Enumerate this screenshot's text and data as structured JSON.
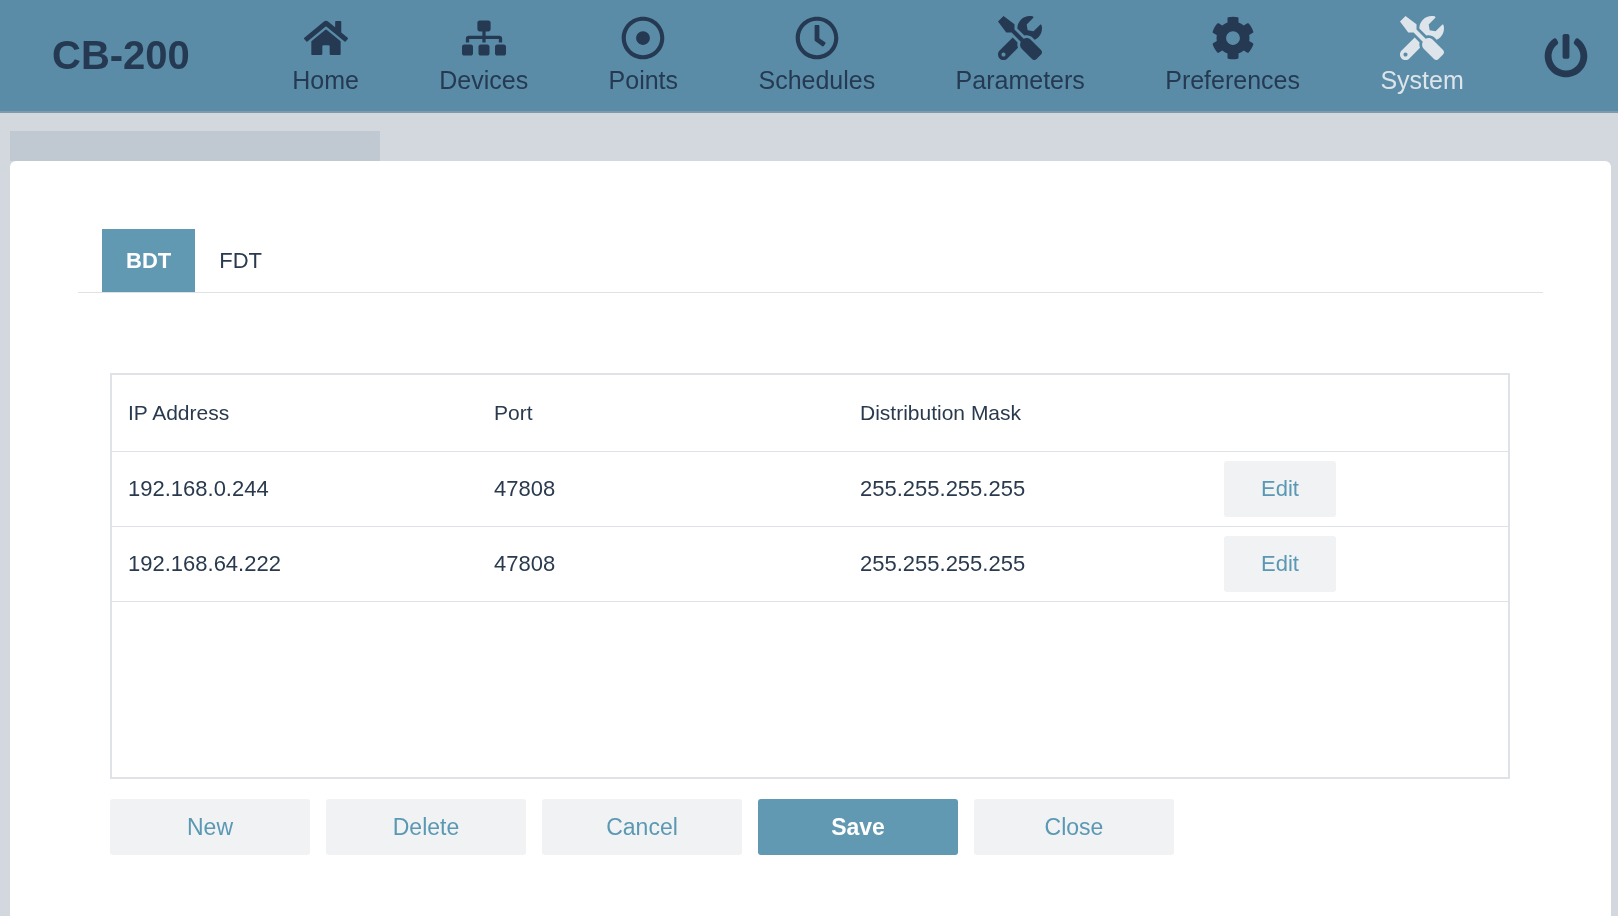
{
  "header": {
    "logo": "CB-200",
    "nav": [
      {
        "label": "Home",
        "kind": "home",
        "selected": false
      },
      {
        "label": "Devices",
        "kind": "devices",
        "selected": false
      },
      {
        "label": "Points",
        "kind": "points",
        "selected": false
      },
      {
        "label": "Schedules",
        "kind": "schedules",
        "selected": false
      },
      {
        "label": "Parameters",
        "kind": "tools",
        "selected": false
      },
      {
        "label": "Preferences",
        "kind": "gear",
        "selected": false
      },
      {
        "label": "System",
        "kind": "tools",
        "selected": true
      }
    ]
  },
  "tabs": [
    {
      "label": "BDT",
      "selected": true
    },
    {
      "label": "FDT",
      "selected": false
    }
  ],
  "table": {
    "columns": [
      "IP Address",
      "Port",
      "Distribution Mask"
    ],
    "rows": [
      {
        "cells": [
          "192.168.0.244",
          "47808",
          "255.255.255.255"
        ],
        "action": "Edit"
      },
      {
        "cells": [
          "192.168.64.222",
          "47808",
          "255.255.255.255"
        ],
        "action": "Edit"
      }
    ]
  },
  "buttons": [
    {
      "label": "New",
      "primary": false
    },
    {
      "label": "Delete",
      "primary": false
    },
    {
      "label": "Cancel",
      "primary": false
    },
    {
      "label": "Save",
      "primary": true
    },
    {
      "label": "Close",
      "primary": false
    }
  ]
}
